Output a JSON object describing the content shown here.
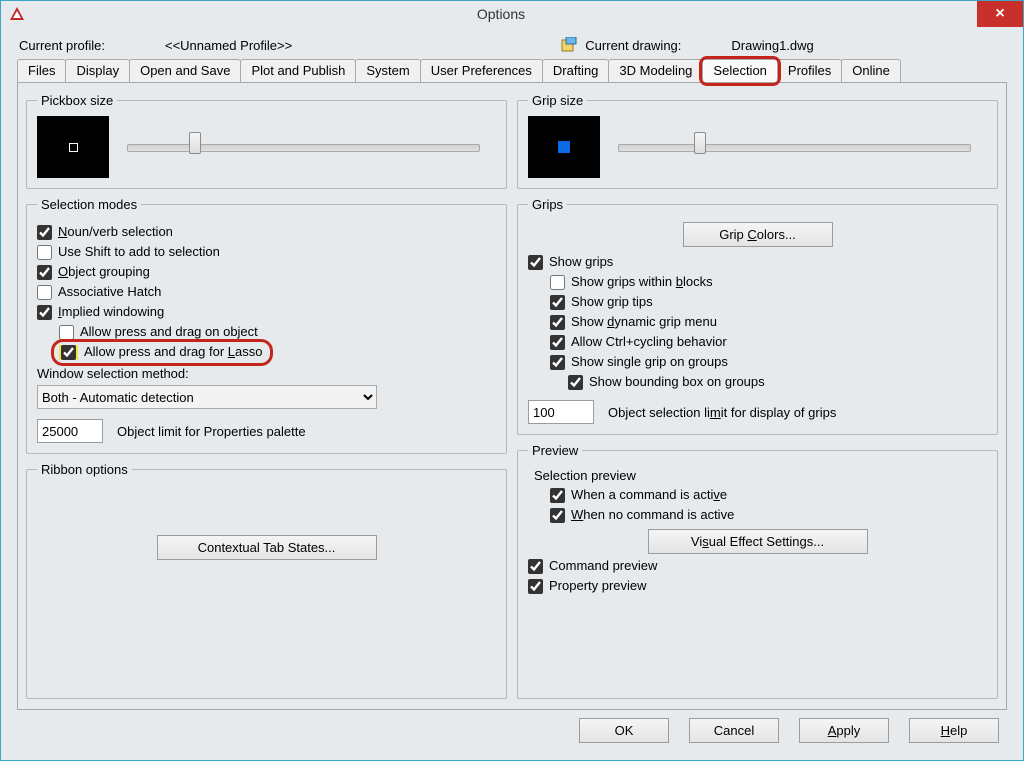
{
  "window": {
    "title": "Options",
    "close_glyph": "×"
  },
  "profile": {
    "current_profile_label": "Current profile:",
    "current_profile_value": "<<Unnamed Profile>>",
    "current_drawing_label": "Current drawing:",
    "current_drawing_value": "Drawing1.dwg"
  },
  "tabs": {
    "files": "Files",
    "display": "Display",
    "open_save": "Open and Save",
    "plot_publish": "Plot and Publish",
    "system": "System",
    "user_prefs": "User Preferences",
    "drafting": "Drafting",
    "modeling": "3D Modeling",
    "selection": "Selection",
    "profiles": "Profiles",
    "online": "Online"
  },
  "pickbox": {
    "legend": "Pickbox size"
  },
  "gripsize": {
    "legend": "Grip size"
  },
  "selection_modes": {
    "legend": "Selection modes",
    "noun_verb": "Noun/verb selection",
    "use_shift": "Use Shift to add to selection",
    "object_grouping": "Object grouping",
    "assoc_hatch": "Associative Hatch",
    "implied_windowing": "Implied windowing",
    "allow_drag_object": "Allow press and drag on object",
    "allow_drag_lasso": "Allow press and drag for Lasso",
    "window_method_label": "Window selection method:",
    "window_method_value": "Both - Automatic detection",
    "object_limit_value": "25000",
    "object_limit_label": "Object limit for Properties palette"
  },
  "ribbon": {
    "legend": "Ribbon options",
    "contextual_btn": "Contextual Tab States..."
  },
  "grips": {
    "legend": "Grips",
    "grip_colors_btn": "Grip Colors...",
    "show_grips": "Show grips",
    "within_blocks": "Show grips within blocks",
    "grip_tips": "Show grip tips",
    "dynamic_menu": "Show dynamic grip menu",
    "ctrl_cycling": "Allow Ctrl+cycling behavior",
    "single_on_groups": "Show single grip on groups",
    "bbox_on_groups": "Show bounding box on groups",
    "obj_sel_limit_value": "100",
    "obj_sel_limit_label": "Object selection limit for display of grips"
  },
  "preview": {
    "legend": "Preview",
    "selection_preview": "Selection preview",
    "when_active": "When a command is active",
    "when_not_active": "When no command is active",
    "visual_effect_btn": "Visual Effect Settings...",
    "command_preview": "Command preview",
    "property_preview": "Property preview"
  },
  "buttons": {
    "ok": "OK",
    "cancel": "Cancel",
    "apply": "Apply",
    "help": "Help"
  }
}
